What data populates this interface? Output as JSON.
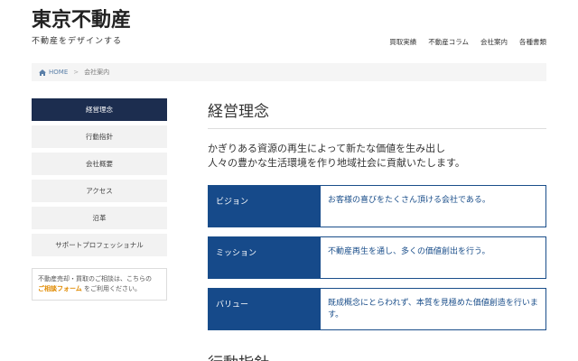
{
  "header": {
    "logo_title": "東京不動産",
    "logo_sub": "不動産をデザインする"
  },
  "gnav": [
    {
      "label": "買取実績"
    },
    {
      "label": "不動産コラム"
    },
    {
      "label": "会社案内"
    },
    {
      "label": "各種書類"
    }
  ],
  "breadcrumb": {
    "home": "HOME",
    "separator": ">",
    "current": "会社案内"
  },
  "sidebar": {
    "items": [
      {
        "label": "経営理念",
        "active": true
      },
      {
        "label": "行動指針"
      },
      {
        "label": "会社概要"
      },
      {
        "label": "アクセス"
      },
      {
        "label": "沿革"
      },
      {
        "label": "サポートプロフェッショナル"
      }
    ],
    "note": {
      "text_before": "不動産売却・買取のご相談は、こちらの",
      "link": "ご相談フォーム",
      "text_after": "をご利用ください。"
    }
  },
  "main": {
    "title": "経営理念",
    "lead_line1": "かぎりある資源の再生によって新たな価値を生み出し",
    "lead_line2": "人々の豊かな生活環境を作り地域社会に貢献いたします。",
    "rows": [
      {
        "label": "ビジョン",
        "value": "お客様の喜びをたくさん頂ける会社である。"
      },
      {
        "label": "ミッション",
        "value": "不動産再生を通し、多くの価値創出を行う。"
      },
      {
        "label": "バリュー",
        "value": "既成概念にとらわれず、本質を見極めた価値創造を行います。"
      }
    ],
    "next_title": "行動指針"
  },
  "colors": {
    "nav_active": "#1c2d4f",
    "row_label_bg": "#164a8a",
    "link_accent": "#e08a00"
  }
}
